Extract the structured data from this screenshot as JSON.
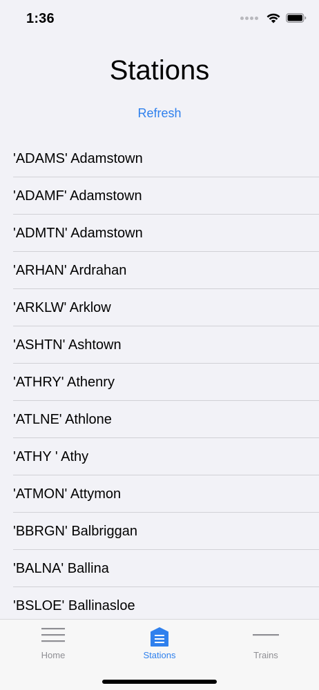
{
  "status_bar": {
    "time": "1:36"
  },
  "header": {
    "title": "Stations",
    "refresh_label": "Refresh"
  },
  "stations": [
    {
      "label": "'ADAMS' Adamstown"
    },
    {
      "label": "'ADAMF' Adamstown"
    },
    {
      "label": "'ADMTN' Adamstown"
    },
    {
      "label": "'ARHAN' Ardrahan"
    },
    {
      "label": "'ARKLW' Arklow"
    },
    {
      "label": "'ASHTN' Ashtown"
    },
    {
      "label": "'ATHRY' Athenry"
    },
    {
      "label": "'ATLNE' Athlone"
    },
    {
      "label": "'ATHY ' Athy"
    },
    {
      "label": "'ATMON' Attymon"
    },
    {
      "label": "'BBRGN' Balbriggan"
    },
    {
      "label": "'BALNA' Ballina"
    },
    {
      "label": "'BSLOE' Ballinasloe"
    }
  ],
  "tab_bar": {
    "tabs": [
      {
        "label": "Home",
        "icon": "menu-lines-icon",
        "active": false
      },
      {
        "label": "Stations",
        "icon": "stations-list-icon",
        "active": true
      },
      {
        "label": "Trains",
        "icon": "train-line-icon",
        "active": false
      }
    ]
  },
  "colors": {
    "accent": "#2f80ed",
    "background": "#f2f2f7",
    "inactive": "#8e8e93",
    "separator": "#d1d1d6"
  }
}
